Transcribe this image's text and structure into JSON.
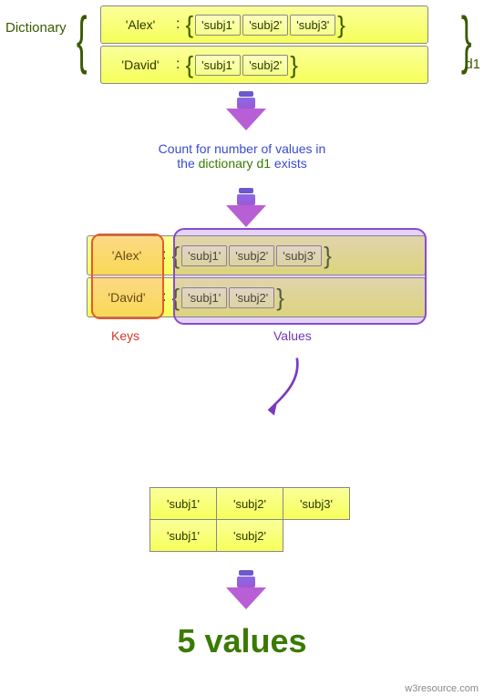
{
  "labels": {
    "dictionary": "Dictionary",
    "d1": "d1",
    "keys": "Keys",
    "values": "Values",
    "footer": "w3resource.com",
    "caption_before": "Count for number of values in",
    "caption_the": "the",
    "caption_dict": "dictionary d1",
    "caption_after": "exists",
    "result": "5 values"
  },
  "dict": {
    "rows": [
      {
        "key": "'Alex'",
        "vals": [
          "'subj1'",
          "'subj2'",
          "'subj3'"
        ]
      },
      {
        "key": "'David'",
        "vals": [
          "'subj1'",
          "'subj2'"
        ]
      }
    ]
  },
  "flat_values": [
    "'subj1'",
    "'subj2'",
    "'subj3'",
    "'subj1'",
    "'subj2'"
  ],
  "chart_data": {
    "type": "table",
    "title": "Count number of values in nested dictionary d1",
    "dictionary_name": "d1",
    "entries": [
      {
        "key": "Alex",
        "values": [
          "subj1",
          "subj2",
          "subj3"
        ]
      },
      {
        "key": "David",
        "values": [
          "subj1",
          "subj2"
        ]
      }
    ],
    "total_value_count": 5,
    "result_text": "5 values"
  }
}
